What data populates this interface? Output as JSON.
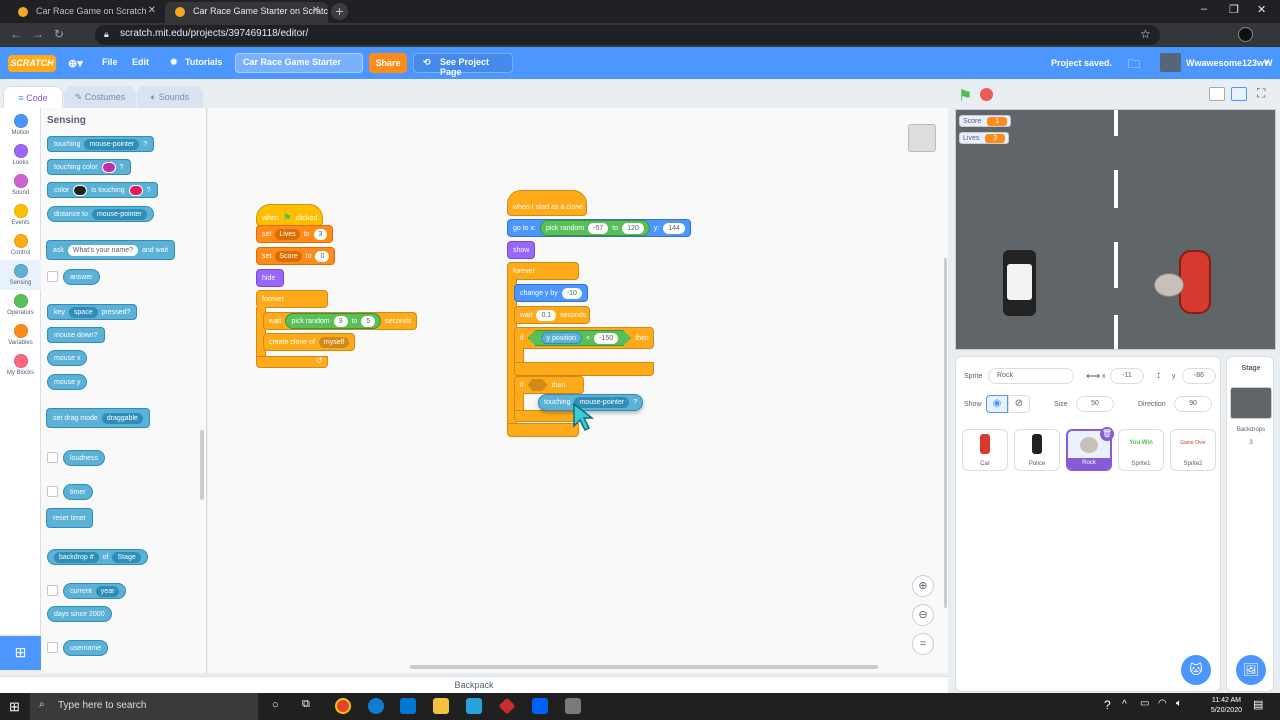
{
  "browser": {
    "tabs": [
      {
        "title": "Car Race Game on Scratch"
      },
      {
        "title": "Car Race Game Starter on Scratch"
      }
    ],
    "url": "scratch.mit.edu/projects/397469118/editor/"
  },
  "menubar": {
    "logo": "SCRATCH",
    "file": "File",
    "edit": "Edit",
    "tutorials": "Tutorials",
    "project_title": "Car Race Game Starter",
    "share": "Share",
    "see_project": "See Project Page",
    "status": "Project saved.",
    "user": "Wwawesome123wW"
  },
  "editor_tabs": {
    "code": "Code",
    "costumes": "Costumes",
    "sounds": "Sounds"
  },
  "categories": [
    {
      "label": "Motion",
      "color": "#4c97ff"
    },
    {
      "label": "Looks",
      "color": "#9966ff"
    },
    {
      "label": "Sound",
      "color": "#cf63cf"
    },
    {
      "label": "Events",
      "color": "#ffbf00"
    },
    {
      "label": "Control",
      "color": "#ffab19"
    },
    {
      "label": "Sensing",
      "color": "#5cb1d6"
    },
    {
      "label": "Operators",
      "color": "#59c059"
    },
    {
      "label": "Variables",
      "color": "#ff8c1a"
    },
    {
      "label": "My Blocks",
      "color": "#ff6680"
    }
  ],
  "palette": {
    "title": "Sensing",
    "touching": "touching",
    "mouse_pointer": "mouse-pointer",
    "q": "?",
    "touching_color": "touching color",
    "color": "color",
    "is_touching": "is touching",
    "distance_to": "distance to",
    "ask": "ask",
    "whats_your_name": "What's your name?",
    "and_wait": "and wait",
    "answer": "answer",
    "key": "key",
    "space": "space",
    "pressed": "pressed?",
    "mouse_down": "mouse down?",
    "mouse_x": "mouse x",
    "mouse_y": "mouse y",
    "set_drag_mode": "set drag mode",
    "draggable": "draggable",
    "loudness": "loudness",
    "timer": "timer",
    "reset_timer": "reset timer",
    "backdrop_num": "backdrop #",
    "of": "of",
    "stage": "Stage",
    "current": "current",
    "year": "year",
    "days_since": "days since 2000",
    "username": "username"
  },
  "script1": {
    "when": "when",
    "clicked": "clicked",
    "set": "set",
    "lives": "Lives",
    "to": "to",
    "lives_val": "3",
    "score": "Score",
    "score_val": "0",
    "hide": "hide",
    "forever": "forever",
    "wait": "wait",
    "pick_random": "pick random",
    "r1": "3",
    "r2": "5",
    "seconds": "seconds",
    "create_clone": "create clone of",
    "myself": "myself"
  },
  "script2": {
    "when_clone": "when I start as a clone",
    "go_to_x": "go to x:",
    "pick_random": "pick random",
    "x1": "-57",
    "to": "to",
    "x2": "120",
    "y_label": "y:",
    "y_val": "144",
    "show": "show",
    "forever": "forever",
    "change_y_by": "change y by",
    "dy": "-10",
    "wait": "wait",
    "wait_val": "0.1",
    "seconds": "seconds",
    "if": "if",
    "y_position": "y position",
    "lt": "<",
    "lim": "-150",
    "then": "then",
    "if2": "if",
    "then2": "then",
    "touching": "touching",
    "mouse_pointer": "mouse-pointer",
    "q": "?"
  },
  "stage": {
    "score_label": "Score",
    "score_val": "1",
    "lives_label": "Lives",
    "lives_val": "3"
  },
  "sprite_info": {
    "sprite_label": "Sprite",
    "sprite_name": "Rock",
    "x_label": "x",
    "x_val": "-11",
    "y_label": "y",
    "y_val": "-86",
    "show_label": "Show",
    "size_label": "Size",
    "size_val": "50",
    "direction_label": "Direction",
    "direction_val": "90"
  },
  "sprites": [
    {
      "name": "Car",
      "thumb": ""
    },
    {
      "name": "Police",
      "thumb": ""
    },
    {
      "name": "Rock",
      "thumb": ""
    },
    {
      "name": "Sprite1",
      "thumb": "You Win"
    },
    {
      "name": "Sprite2",
      "thumb": "Game Over"
    }
  ],
  "stage_pane": {
    "title": "Stage",
    "backdrops": "Backdrops",
    "backdrops_count": "3"
  },
  "backpack": "Backpack",
  "taskbar": {
    "search": "Type here to search",
    "time": "11:42 AM",
    "date": "5/20/2020"
  }
}
